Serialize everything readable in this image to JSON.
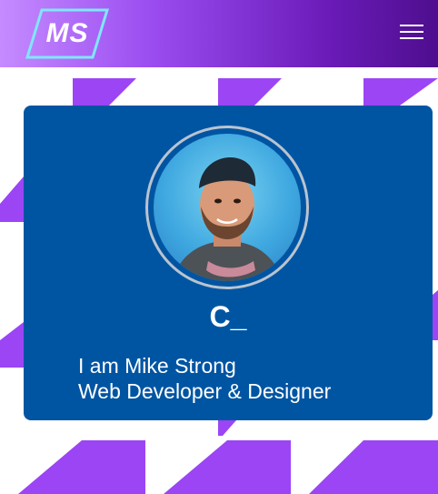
{
  "header": {
    "logo_text": "MS",
    "menu_icon": "hamburger-menu-icon"
  },
  "hero": {
    "typed_text": "C_",
    "line1": "I am Mike Strong",
    "line2": "Web Developer & Designer"
  },
  "colors": {
    "accent_purple": "#9b45f5",
    "card_blue": "#0055a3",
    "logo_outline": "#7fe7ff"
  }
}
